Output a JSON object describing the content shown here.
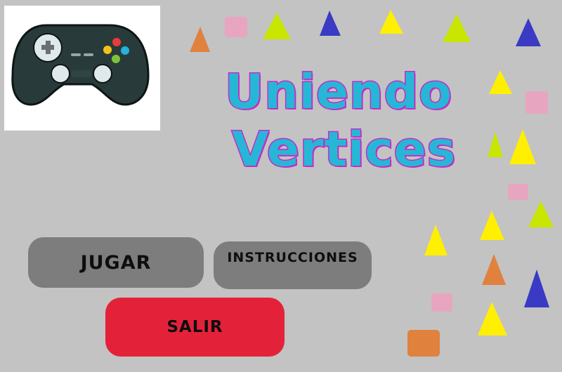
{
  "title": {
    "line1": "Uniendo",
    "line2": "Vertices"
  },
  "menu": {
    "play_label": "JUGAR",
    "instructions_label": "INSTRUCCIONES",
    "exit_label": "SALIR"
  },
  "logo": {
    "icon": "gamepad-icon"
  },
  "colors": {
    "background": "#c3c3c3",
    "title_fill": "#27b7d6",
    "title_outline": "#c12ec7",
    "button_gray": "#7d7d7d",
    "button_exit": "#e3223a",
    "yellow": "#ffef00",
    "lime": "#c8e600",
    "blue": "#3a3ac4",
    "orange": "#e0813e",
    "pink": "#e8a5c0"
  }
}
